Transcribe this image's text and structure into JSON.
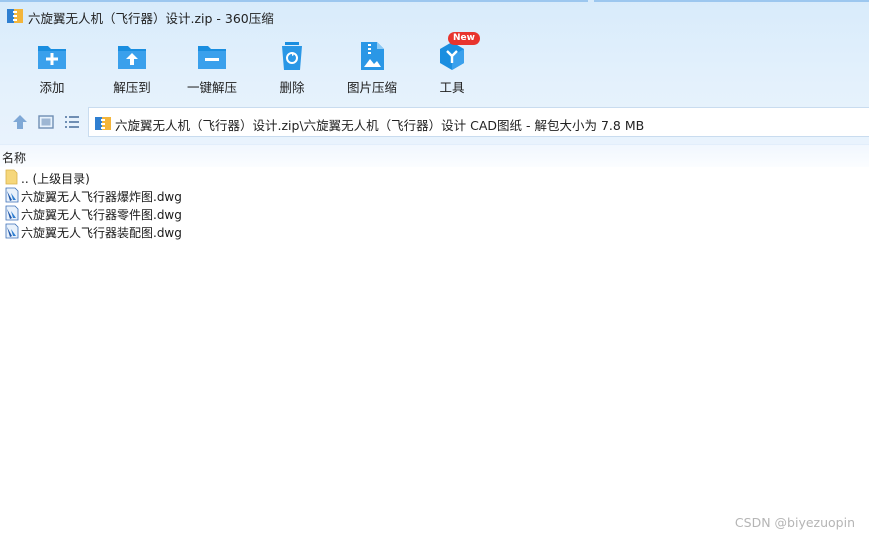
{
  "window": {
    "title": "六旋翼无人机（飞行器）设计.zip - 360压缩"
  },
  "toolbar": {
    "items": [
      {
        "label": "添加",
        "icon": "add-folder-icon"
      },
      {
        "label": "解压到",
        "icon": "extract-to-icon"
      },
      {
        "label": "一键解压",
        "icon": "one-click-extract-icon"
      },
      {
        "label": "删除",
        "icon": "delete-icon"
      },
      {
        "label": "图片压缩",
        "icon": "image-compress-icon"
      },
      {
        "label": "工具",
        "icon": "tools-icon",
        "badge": "New"
      }
    ]
  },
  "nav": {
    "up_icon": "up-arrow-icon",
    "view_icon": "view-toggle-icon",
    "list_icon": "list-view-icon",
    "path": "六旋翼无人机（飞行器）设计.zip\\六旋翼无人机（飞行器）设计 CAD图纸 - 解包大小为 7.8 MB"
  },
  "columns": {
    "name": "名称"
  },
  "files": [
    {
      "name": ".. (上级目录)",
      "icon": "folder-icon"
    },
    {
      "name": "六旋翼无人飞行器爆炸图.dwg",
      "icon": "dwg-file-icon"
    },
    {
      "name": "六旋翼无人飞行器零件图.dwg",
      "icon": "dwg-file-icon"
    },
    {
      "name": "六旋翼无人飞行器装配图.dwg",
      "icon": "dwg-file-icon"
    }
  ],
  "watermark": "CSDN @biyezuopin",
  "colors": {
    "accent": "#1a8ee0",
    "chrome_bg": "#e4f1fc",
    "badge": "#e8342e"
  }
}
